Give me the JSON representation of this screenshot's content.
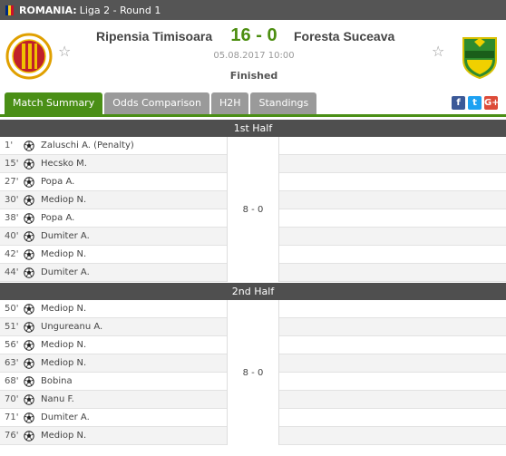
{
  "topbar": {
    "country": "ROMANIA:",
    "league": "Liga 2 - Round 1",
    "flag_colors": [
      "#002b7f",
      "#fcd116",
      "#ce1126"
    ]
  },
  "match": {
    "home_team": "Ripensia Timisoara",
    "away_team": "Foresta Suceava",
    "score": "16 - 0",
    "datetime": "05.08.2017 10:00",
    "status": "Finished",
    "score_color": "#4c8e10"
  },
  "tabs": [
    {
      "label": "Match Summary",
      "active": true
    },
    {
      "label": "Odds Comparison",
      "active": false
    },
    {
      "label": "H2H",
      "active": false
    },
    {
      "label": "Standings",
      "active": false
    }
  ],
  "social": {
    "facebook": "f",
    "twitter": "t",
    "google": "G+"
  },
  "halves": [
    {
      "title": "1st Half",
      "score": "8 - 0",
      "events": [
        {
          "minute": "1'",
          "player": "Zaluschi A. (Penalty)"
        },
        {
          "minute": "15'",
          "player": "Hecsko M."
        },
        {
          "minute": "27'",
          "player": "Popa A."
        },
        {
          "minute": "30'",
          "player": "Mediop N."
        },
        {
          "minute": "38'",
          "player": "Popa A."
        },
        {
          "minute": "40'",
          "player": "Dumiter A."
        },
        {
          "minute": "42'",
          "player": "Mediop N."
        },
        {
          "minute": "44'",
          "player": "Dumiter A."
        }
      ]
    },
    {
      "title": "2nd Half",
      "score": "8 - 0",
      "events": [
        {
          "minute": "50'",
          "player": "Mediop N."
        },
        {
          "minute": "51'",
          "player": "Ungureanu A."
        },
        {
          "minute": "56'",
          "player": "Mediop N."
        },
        {
          "minute": "63'",
          "player": "Mediop N."
        },
        {
          "minute": "68'",
          "player": "Bobina"
        },
        {
          "minute": "70'",
          "player": "Nanu F."
        },
        {
          "minute": "71'",
          "player": "Dumiter A."
        },
        {
          "minute": "76'",
          "player": "Mediop N."
        }
      ]
    }
  ]
}
